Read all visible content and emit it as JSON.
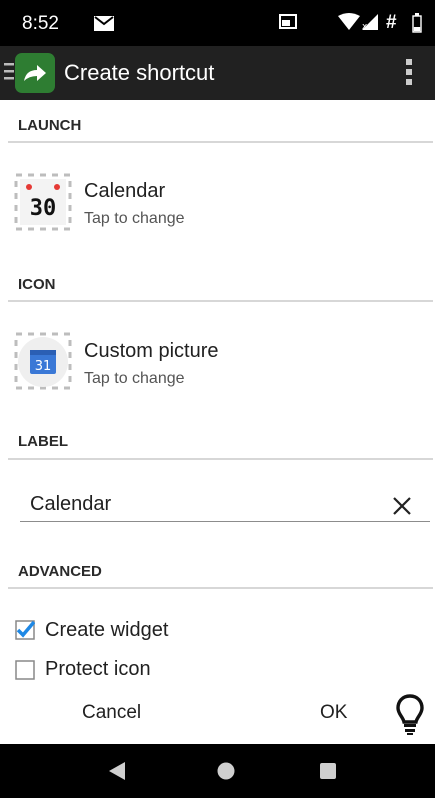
{
  "status_bar": {
    "time": "8:52",
    "hash": "#"
  },
  "app_bar": {
    "title": "Create shortcut"
  },
  "launch": {
    "header": "LAUNCH",
    "title": "Calendar",
    "subtitle": "Tap to change",
    "icon_day": "30"
  },
  "icon_section": {
    "header": "ICON",
    "title": "Custom picture",
    "subtitle": "Tap to change",
    "icon_day": "31"
  },
  "label_section": {
    "header": "LABEL",
    "value": "Calendar"
  },
  "advanced": {
    "header": "ADVANCED",
    "create_widget": {
      "label": "Create widget",
      "checked": true
    },
    "protect_icon": {
      "label": "Protect icon",
      "checked": false
    }
  },
  "actions": {
    "cancel": "Cancel",
    "ok": "OK"
  },
  "colors": {
    "app_icon_green": "#2e7d32",
    "checkbox_blue": "#1e88e5",
    "calendar_blue": "#3a78d6"
  }
}
